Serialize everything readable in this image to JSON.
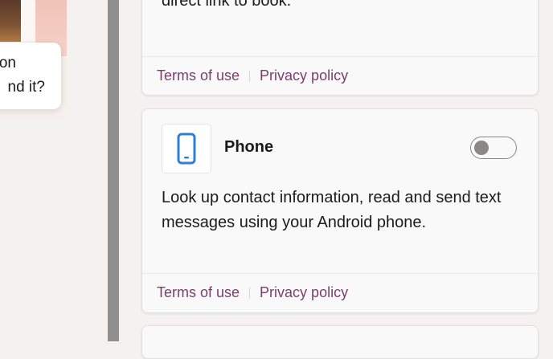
{
  "left_panel": {
    "bubble_line_1": "on",
    "bubble_line_2": "nd it?"
  },
  "cards": {
    "top": {
      "description": "direct link to book.",
      "footer": {
        "terms": "Terms of use",
        "privacy": "Privacy policy"
      }
    },
    "phone": {
      "icon": "phone-icon",
      "title": "Phone",
      "toggle_state": "off",
      "description": "Look up contact information, read and send text messages using your Android phone.",
      "footer": {
        "terms": "Terms of use",
        "privacy": "Privacy policy"
      }
    }
  },
  "colors": {
    "link": "#7a3d6f",
    "icon_blue": "#2f7fd4",
    "toggle_gray": "#8a8886"
  }
}
